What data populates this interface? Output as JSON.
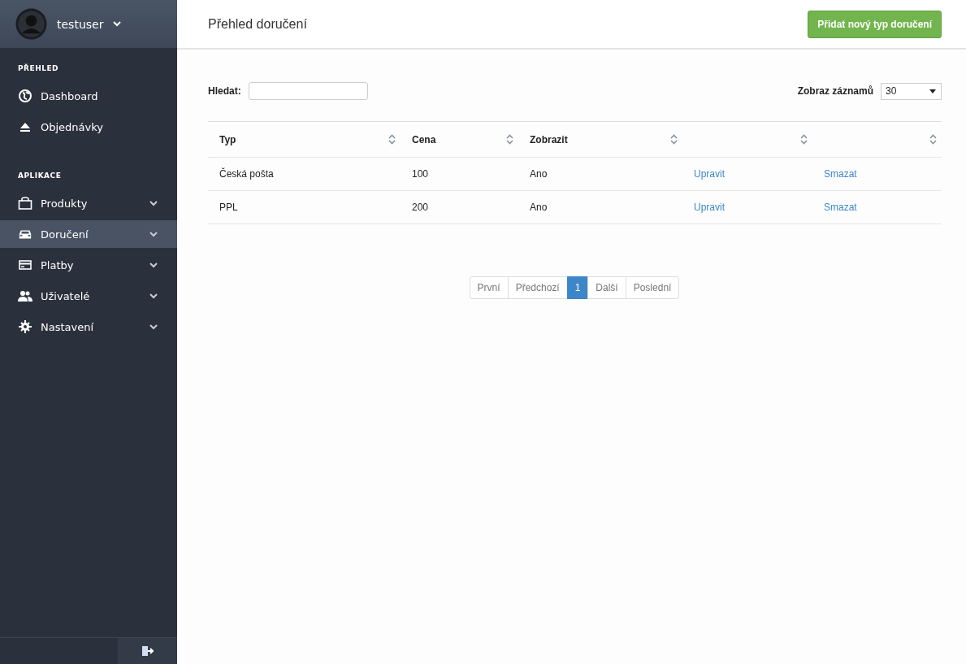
{
  "sidebar": {
    "user": {
      "name": "testuser"
    },
    "sections": [
      {
        "title": "PŘEHLED",
        "items": [
          {
            "label": "Dashboard",
            "selected": false,
            "expandable": false
          },
          {
            "label": "Objednávky",
            "selected": false,
            "expandable": false
          }
        ]
      },
      {
        "title": "APLIKACE",
        "items": [
          {
            "label": "Produkty",
            "selected": false,
            "expandable": true
          },
          {
            "label": "Doručení",
            "selected": true,
            "expandable": true
          },
          {
            "label": "Platby",
            "selected": false,
            "expandable": true
          },
          {
            "label": "Uživatelé",
            "selected": false,
            "expandable": true
          },
          {
            "label": "Nastavení",
            "selected": false,
            "expandable": true
          }
        ]
      }
    ]
  },
  "header": {
    "title": "Přehled doručení",
    "add_button": "Přidat nový typ doručení"
  },
  "filters": {
    "search_label": "Hledat:",
    "page_size_label": "Zobraz záznamů",
    "page_size": "30"
  },
  "table": {
    "columns": [
      {
        "label": "Typ"
      },
      {
        "label": "Cena"
      },
      {
        "label": "Zobrazit"
      },
      {},
      {}
    ],
    "rows": [
      {
        "cells": [
          "Česká pošta",
          "100",
          "Ano"
        ],
        "actions": [
          "Upravit",
          "Smazat"
        ]
      },
      {
        "cells": [
          "PPL",
          "200",
          "Ano"
        ],
        "actions": [
          "Upravit",
          "Smazat"
        ]
      }
    ]
  },
  "pagination": [
    {
      "label": "První",
      "selected": false
    },
    {
      "label": "Předchozí",
      "selected": false
    },
    {
      "label": "1",
      "selected": true
    },
    {
      "label": "Další",
      "selected": false
    },
    {
      "label": "Poslední",
      "selected": false
    }
  ]
}
